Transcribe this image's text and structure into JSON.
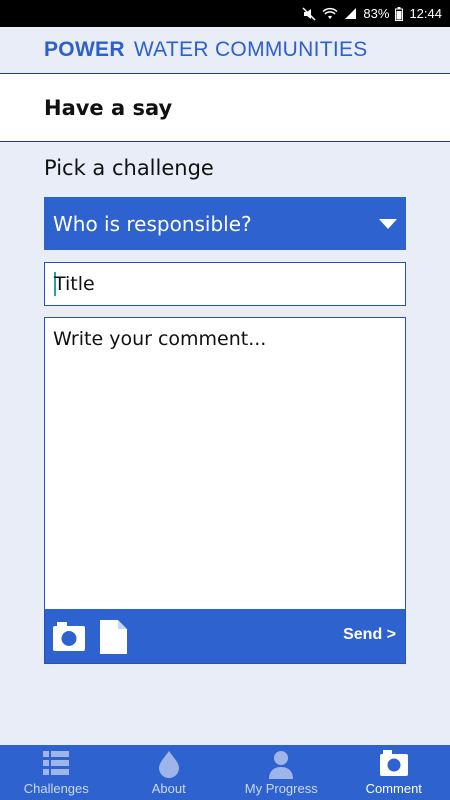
{
  "status_bar": {
    "battery": "83%",
    "time": "12:44"
  },
  "app_header": {
    "brand_bold": "POWER",
    "brand_rest": "WATER COMMUNITIES"
  },
  "page": {
    "title": "Have a say"
  },
  "challenge": {
    "label": "Pick a challenge",
    "selected": "Who is responsible?"
  },
  "form": {
    "title_placeholder": "Title",
    "comment_placeholder": "Write your comment...",
    "send_label": "Send >"
  },
  "bottom_nav": {
    "items": [
      {
        "label": "Challenges",
        "icon": "list-icon"
      },
      {
        "label": "About",
        "icon": "water-drop-icon"
      },
      {
        "label": "My Progress",
        "icon": "person-icon"
      },
      {
        "label": "Comment",
        "icon": "camera-icon"
      }
    ],
    "active": "Comment"
  },
  "colors": {
    "primary": "#2e63cf",
    "background": "#e9edf8",
    "brand_text": "#2e5fcc"
  }
}
